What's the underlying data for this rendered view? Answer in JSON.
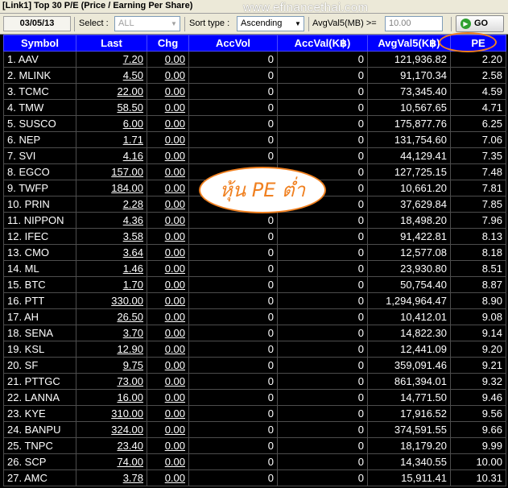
{
  "window": {
    "title": "[Link1] Top 30 P/E (Price / Earning Per Share)"
  },
  "watermark": "www.efinancethai.com",
  "toolbar": {
    "date": "03/05/13",
    "select_label": "Select :",
    "select_value": "ALL",
    "sort_label": "Sort type :",
    "sort_value": "Ascending",
    "avg_label": "AvgVal5(MB) >=",
    "avg_placeholder": "10.00",
    "go_label": "GO"
  },
  "annotation": "หุ้น PE ต่ำ",
  "columns": [
    "Symbol",
    "Last",
    "Chg",
    "AccVol",
    "AccVal(K฿)",
    "AvgVal5(K฿)",
    "PE"
  ],
  "rows": [
    [
      "1. AAV",
      "7.20",
      "0.00",
      "0",
      "0",
      "121,936.82",
      "2.20"
    ],
    [
      "2. MLINK",
      "4.50",
      "0.00",
      "0",
      "0",
      "91,170.34",
      "2.58"
    ],
    [
      "3. TCMC",
      "22.00",
      "0.00",
      "0",
      "0",
      "73,345.40",
      "4.59"
    ],
    [
      "4. TMW",
      "58.50",
      "0.00",
      "0",
      "0",
      "10,567.65",
      "4.71"
    ],
    [
      "5. SUSCO",
      "6.00",
      "0.00",
      "0",
      "0",
      "175,877.76",
      "6.25"
    ],
    [
      "6. NEP",
      "1.71",
      "0.00",
      "0",
      "0",
      "131,754.60",
      "7.06"
    ],
    [
      "7. SVI",
      "4.16",
      "0.00",
      "0",
      "0",
      "44,129.41",
      "7.35"
    ],
    [
      "8. EGCO",
      "157.00",
      "0.00",
      "0",
      "0",
      "127,725.15",
      "7.48"
    ],
    [
      "9. TWFP",
      "184.00",
      "0.00",
      "0",
      "0",
      "10,661.20",
      "7.81"
    ],
    [
      "10. PRIN",
      "2.28",
      "0.00",
      "0",
      "0",
      "37,629.84",
      "7.85"
    ],
    [
      "11. NIPPON",
      "4.36",
      "0.00",
      "0",
      "0",
      "18,498.20",
      "7.96"
    ],
    [
      "12. IFEC",
      "3.58",
      "0.00",
      "0",
      "0",
      "91,422.81",
      "8.13"
    ],
    [
      "13. CMO",
      "3.64",
      "0.00",
      "0",
      "0",
      "12,577.08",
      "8.18"
    ],
    [
      "14. ML",
      "1.46",
      "0.00",
      "0",
      "0",
      "23,930.80",
      "8.51"
    ],
    [
      "15. BTC",
      "1.70",
      "0.00",
      "0",
      "0",
      "50,754.40",
      "8.87"
    ],
    [
      "16. PTT",
      "330.00",
      "0.00",
      "0",
      "0",
      "1,294,964.47",
      "8.90"
    ],
    [
      "17. AH",
      "26.50",
      "0.00",
      "0",
      "0",
      "10,412.01",
      "9.08"
    ],
    [
      "18. SENA",
      "3.70",
      "0.00",
      "0",
      "0",
      "14,822.30",
      "9.14"
    ],
    [
      "19. KSL",
      "12.90",
      "0.00",
      "0",
      "0",
      "12,441.09",
      "9.20"
    ],
    [
      "20. SF",
      "9.75",
      "0.00",
      "0",
      "0",
      "359,091.46",
      "9.21"
    ],
    [
      "21. PTTGC",
      "73.00",
      "0.00",
      "0",
      "0",
      "861,394.01",
      "9.32"
    ],
    [
      "22. LANNA",
      "16.00",
      "0.00",
      "0",
      "0",
      "14,771.50",
      "9.46"
    ],
    [
      "23. KYE",
      "310.00",
      "0.00",
      "0",
      "0",
      "17,916.52",
      "9.56"
    ],
    [
      "24. BANPU",
      "324.00",
      "0.00",
      "0",
      "0",
      "374,591.55",
      "9.66"
    ],
    [
      "25. TNPC",
      "23.40",
      "0.00",
      "0",
      "0",
      "18,179.20",
      "9.99"
    ],
    [
      "26. SCP",
      "74.00",
      "0.00",
      "0",
      "0",
      "14,340.55",
      "10.00"
    ],
    [
      "27. AMC",
      "3.78",
      "0.00",
      "0",
      "0",
      "15,911.41",
      "10.31"
    ]
  ],
  "colors": {
    "header_bg": "#0000ff",
    "pe_header_bg": "#ff0000",
    "symbol_text": "#ffff00",
    "annotation": "#f08020"
  }
}
